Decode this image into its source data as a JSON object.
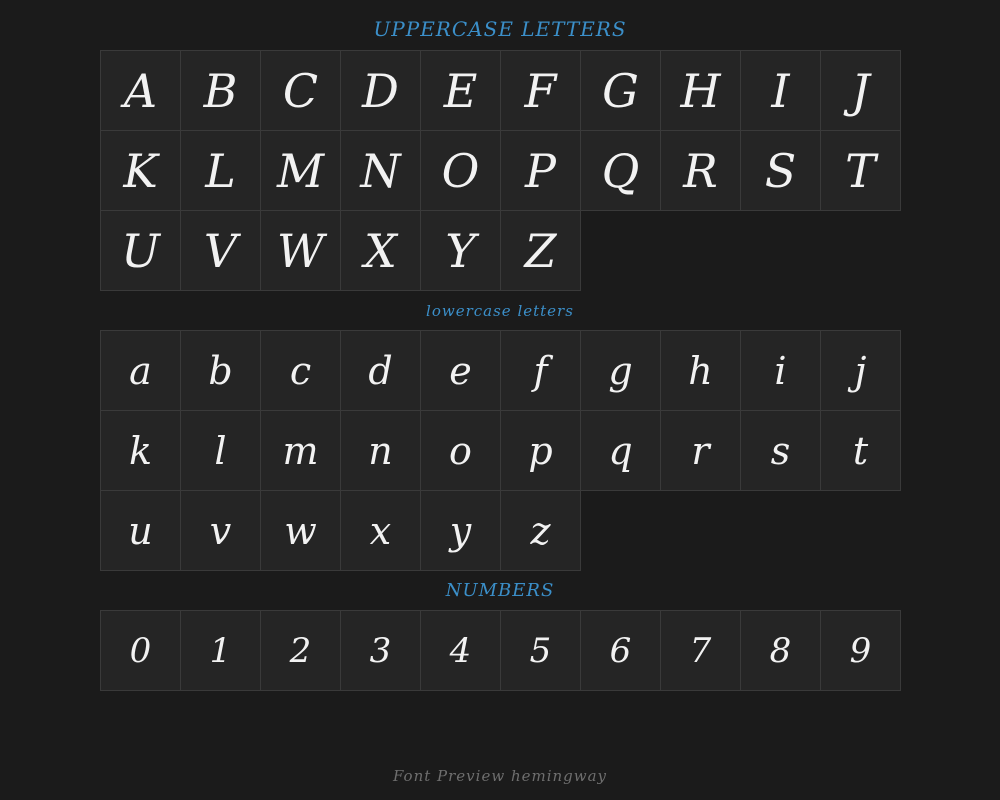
{
  "uppercase": {
    "heading": "UPPERCASE LETTERS",
    "glyphs": [
      "A",
      "B",
      "C",
      "D",
      "E",
      "F",
      "G",
      "H",
      "I",
      "J",
      "K",
      "L",
      "M",
      "N",
      "O",
      "P",
      "Q",
      "R",
      "S",
      "T",
      "U",
      "V",
      "W",
      "X",
      "Y",
      "Z"
    ]
  },
  "lowercase": {
    "heading": "lowercase letters",
    "glyphs": [
      "a",
      "b",
      "c",
      "d",
      "e",
      "f",
      "g",
      "h",
      "i",
      "j",
      "k",
      "l",
      "m",
      "n",
      "o",
      "p",
      "q",
      "r",
      "s",
      "t",
      "u",
      "v",
      "w",
      "x",
      "y",
      "z"
    ]
  },
  "numbers": {
    "heading": "NUMBERS",
    "glyphs": [
      "0",
      "1",
      "2",
      "3",
      "4",
      "5",
      "6",
      "7",
      "8",
      "9"
    ]
  },
  "footer": {
    "font_name": "Font Preview hemingway"
  }
}
